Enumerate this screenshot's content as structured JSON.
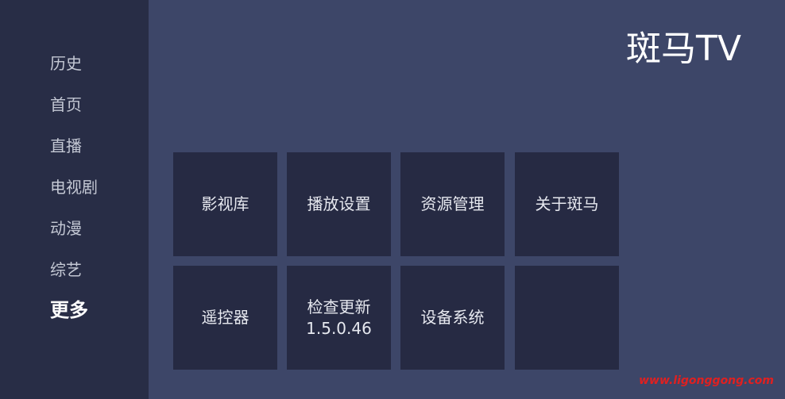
{
  "sidebar": {
    "items": [
      {
        "label": "历史"
      },
      {
        "label": "首页"
      },
      {
        "label": "直播"
      },
      {
        "label": "电视剧"
      },
      {
        "label": "动漫"
      },
      {
        "label": "综艺"
      },
      {
        "label": "更多",
        "active": true
      }
    ]
  },
  "header": {
    "brand": "斑马TV"
  },
  "grid": {
    "tiles": [
      {
        "label": "影视库"
      },
      {
        "label": "播放设置"
      },
      {
        "label": "资源管理"
      },
      {
        "label": "关于斑马"
      },
      {
        "label": "遥控器"
      },
      {
        "label": "检查更新",
        "version": "1.5.0.46"
      },
      {
        "label": "设备系统"
      },
      {
        "label": ""
      }
    ]
  },
  "watermark": "www.ligonggong.com"
}
